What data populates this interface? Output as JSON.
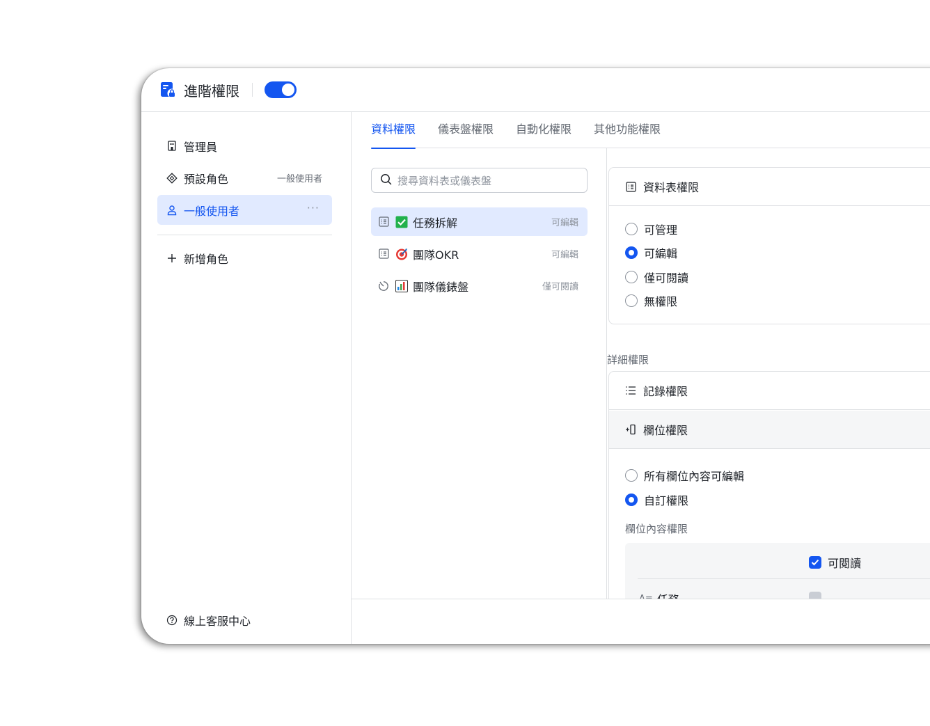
{
  "app": {
    "title": "進階權限",
    "toggle_on": true
  },
  "sidebar": {
    "items": [
      {
        "label": "管理員",
        "icon": "building-icon"
      },
      {
        "label": "預設角色",
        "icon": "diamond-icon",
        "sub": "一般使用者"
      },
      {
        "label": "一般使用者",
        "icon": "user-icon",
        "more": "···"
      }
    ],
    "add_role": "新增角色",
    "help": "線上客服中心"
  },
  "tabs": [
    "資料權限",
    "儀表盤權限",
    "自動化權限",
    "其他功能權限"
  ],
  "search": {
    "placeholder": "搜尋資料表或儀表盤"
  },
  "list": [
    {
      "name": "任務拆解",
      "perm": "可編輯",
      "icon": "table-icon",
      "emoji": "check-emoji"
    },
    {
      "name": "團隊OKR",
      "perm": "可編輯",
      "icon": "table-icon",
      "emoji": "target-emoji"
    },
    {
      "name": "團隊儀錶盤",
      "perm": "僅可閱讀",
      "icon": "dashboard-icon",
      "emoji": "chart-emoji"
    }
  ],
  "table_perm": {
    "title": "資料表權限",
    "options": [
      "可管理",
      "可編輯",
      "僅可閱讀",
      "無權限"
    ],
    "selected": "可編輯"
  },
  "detail": {
    "label": "詳細權限",
    "record_perm": "記錄權限",
    "field_perm": "欄位權限",
    "field_options": [
      "所有欄位內容可編輯",
      "自訂權限"
    ],
    "field_selected": "自訂權限",
    "field_content_label": "欄位內容權限",
    "readable_label": "可閱讀",
    "row_partial": "任務"
  },
  "colors": {
    "accent": "#1456f0",
    "accent_bg": "#e1eaff"
  }
}
